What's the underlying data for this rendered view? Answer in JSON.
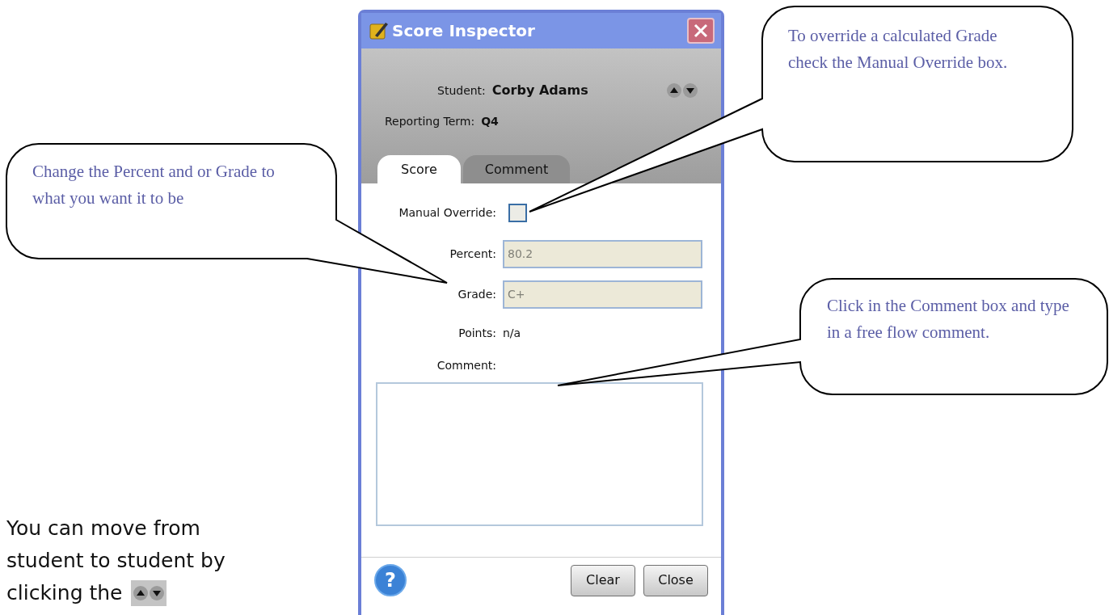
{
  "dialog": {
    "title": "Score Inspector",
    "student_label": "Student:",
    "student_name": "Corby Adams",
    "term_label": "Reporting Term:",
    "term_value": "Q4",
    "tabs": [
      {
        "label": "Score",
        "selected": true
      },
      {
        "label": "Comment",
        "selected": false
      }
    ],
    "manual_override": {
      "label": "Manual Override:",
      "checked": false
    },
    "fields": [
      {
        "label": "Percent:",
        "value": "80.2",
        "disabled": true
      },
      {
        "label": "Grade:",
        "value": "C+",
        "disabled": true
      }
    ],
    "points": {
      "label": "Points:",
      "value": "n/a"
    },
    "comment": {
      "label": "Comment:"
    },
    "help_button": "?",
    "buttons": [
      "Clear",
      "Close"
    ]
  },
  "callouts": [
    "To override a calculated Grade check the Manual Override box.",
    "Change the Percent and or Grade to what you want it to be",
    "Click in the Comment box and type in a free flow comment."
  ],
  "instruction_lines": [
    "You can move from",
    "student to student by",
    "clicking the"
  ]
}
